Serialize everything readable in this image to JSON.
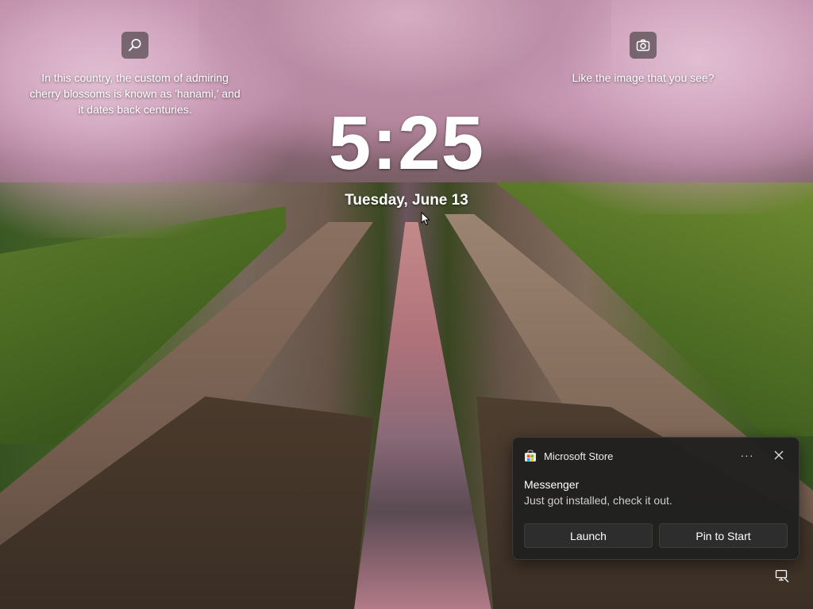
{
  "spotlight": {
    "fact_text": "In this country, the custom of admiring cherry blossoms is known as 'hanami,' and it dates back centuries.",
    "feedback_text": "Like the image that you see?",
    "search_icon": "search-icon",
    "camera_icon": "camera-icon"
  },
  "clock": {
    "time": "5:25",
    "date": "Tuesday, June 13"
  },
  "toast": {
    "app_name": "Microsoft Store",
    "title": "Messenger",
    "body": "Just got installed, check it out.",
    "more_label": "···",
    "launch_label": "Launch",
    "pin_label": "Pin to Start",
    "colors": {
      "background": "#202020",
      "button": "#2d2d2d"
    }
  },
  "status": {
    "network_icon": "network-icon"
  }
}
